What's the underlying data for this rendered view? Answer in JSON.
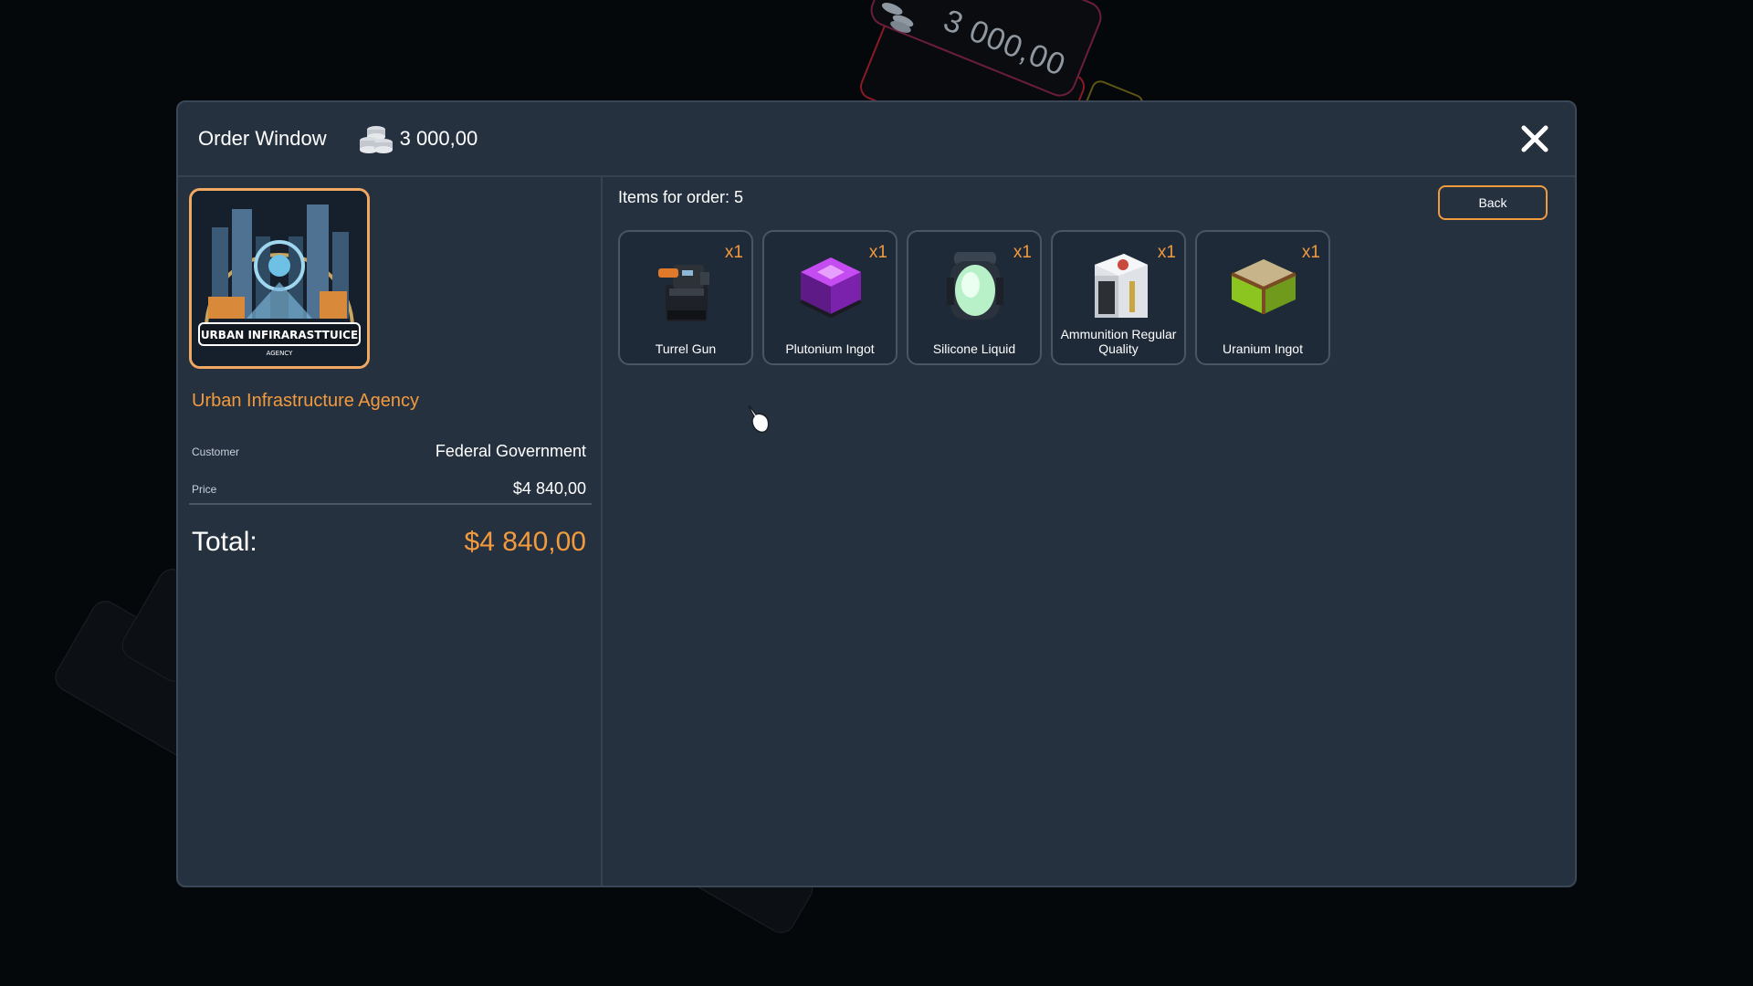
{
  "background": {
    "amount": "3 000,00"
  },
  "window": {
    "title": "Order Window",
    "balance": "3 000,00"
  },
  "order": {
    "logo_text": "URBAN INFIRARASTTUICE",
    "logo_subtext": "AGENCY",
    "company": "Urban Infrastructure Agency",
    "customer_label": "Customer",
    "customer_value": "Federal Government",
    "price_label": "Price",
    "price_value": "$4 840,00",
    "total_label": "Total:",
    "total_value": "$4 840,00"
  },
  "items_panel": {
    "count_label": "Items for order: 5",
    "back_label": "Back",
    "items": [
      {
        "name": "Turrel Gun",
        "qty": "x1",
        "icon": "turret-gun-icon"
      },
      {
        "name": "Plutonium Ingot",
        "qty": "x1",
        "icon": "plutonium-ingot-icon"
      },
      {
        "name": "Silicone Liquid",
        "qty": "x1",
        "icon": "silicone-liquid-icon"
      },
      {
        "name": "Ammunition Regular Quality",
        "qty": "x1",
        "icon": "ammunition-box-icon"
      },
      {
        "name": "Uranium Ingot",
        "qty": "x1",
        "icon": "uranium-ingot-icon"
      }
    ]
  },
  "colors": {
    "accent": "#f29a3e",
    "panel": "#263140",
    "border": "#3b4757"
  }
}
